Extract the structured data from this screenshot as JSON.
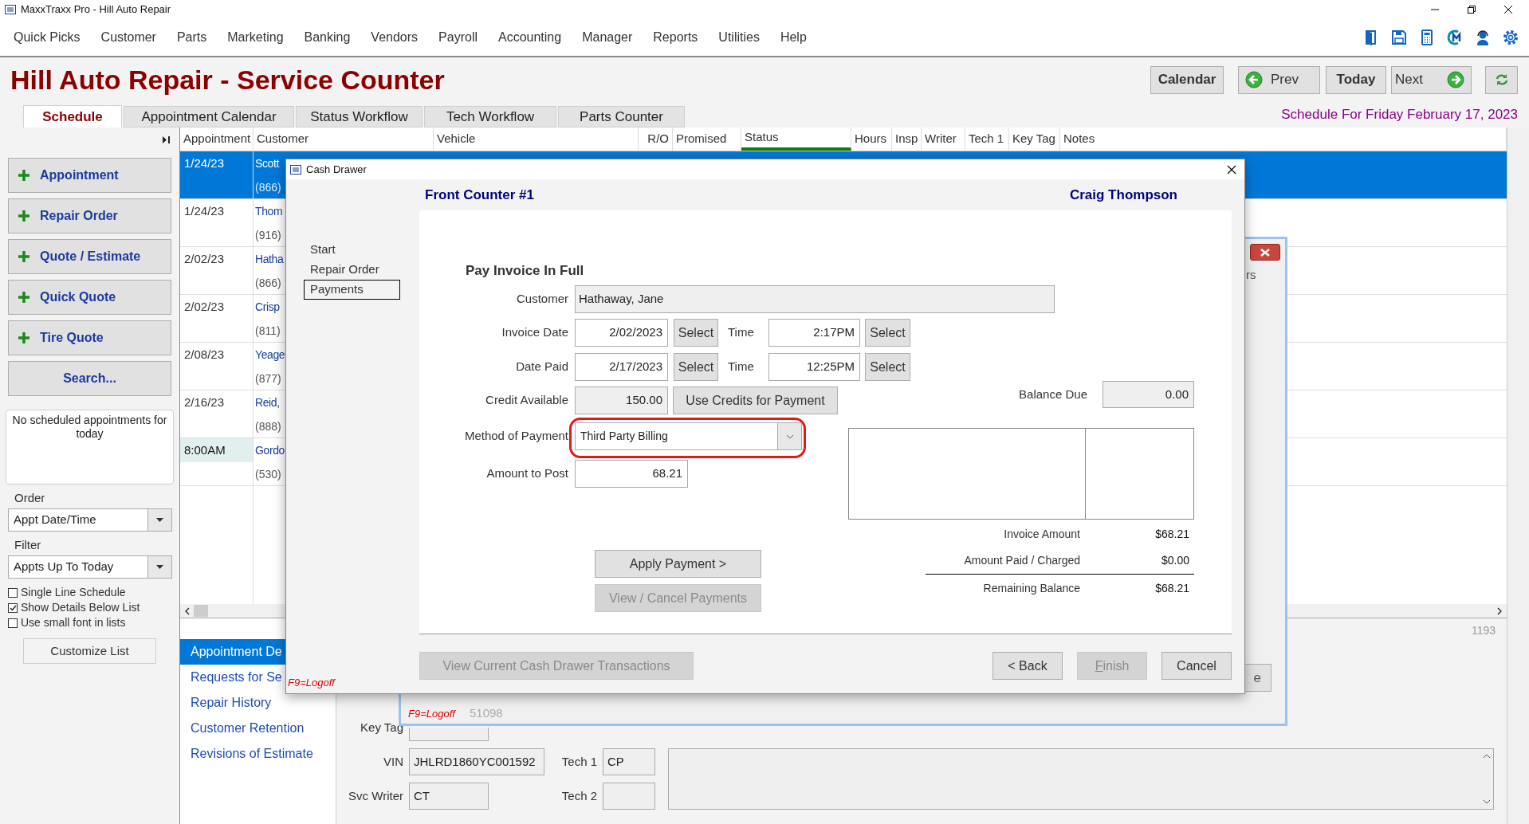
{
  "window": {
    "title": "MaxxTraxx Pro - Hill Auto Repair"
  },
  "menu": [
    "Quick Picks",
    "Customer",
    "Parts",
    "Marketing",
    "Banking",
    "Vendors",
    "Payroll",
    "Accounting",
    "Manager",
    "Reports",
    "Utilities",
    "Help"
  ],
  "header": {
    "title": "Hill Auto Repair - Service Counter",
    "buttons": [
      {
        "kind": "calendar",
        "label": "Calendar"
      },
      {
        "kind": "prev",
        "label": "Prev"
      },
      {
        "kind": "today",
        "label": "Today"
      },
      {
        "kind": "next",
        "label": "Next"
      },
      {
        "kind": "refresh"
      }
    ]
  },
  "tabs": [
    {
      "label": "Schedule",
      "selected": true
    },
    {
      "label": "Appointment Calendar",
      "selected": false
    },
    {
      "label": "Status Workflow",
      "selected": false
    },
    {
      "label": "Tech Workflow",
      "selected": false
    },
    {
      "label": "Parts Counter",
      "selected": false
    }
  ],
  "schedule_date": "Schedule For Friday February 17, 2023",
  "sidebar": {
    "actions": [
      {
        "kind": "add",
        "label": "Appointment"
      },
      {
        "kind": "add",
        "label": "Repair Order"
      },
      {
        "kind": "add",
        "label": "Quote / Estimate"
      },
      {
        "kind": "add",
        "label": "Quick Quote"
      },
      {
        "kind": "add",
        "label": "Tire Quote"
      },
      {
        "kind": "search",
        "label": "Search..."
      }
    ],
    "empty_message": "No scheduled appointments for today",
    "order": {
      "label": "Order",
      "value": "Appt Date/Time"
    },
    "filter": {
      "label": "Filter",
      "value": "Appts Up To Today"
    },
    "options": [
      {
        "label": "Single Line Schedule",
        "checked": false
      },
      {
        "label": "Show Details Below List",
        "checked": true
      },
      {
        "label": "Use small font in lists",
        "checked": false
      }
    ],
    "customize_button": "Customize List"
  },
  "schedule": {
    "columns": [
      {
        "label": "Appointment",
        "sorted": false
      },
      {
        "label": "Customer",
        "sorted": false
      },
      {
        "label": "Vehicle",
        "sorted": false
      },
      {
        "label": "R/O",
        "sorted": false
      },
      {
        "label": "Promised",
        "sorted": false
      },
      {
        "label": "Status",
        "sorted": true
      },
      {
        "label": "Hours",
        "sorted": false
      },
      {
        "label": "Insp",
        "sorted": false
      },
      {
        "label": "Writer",
        "sorted": false
      },
      {
        "label": "Tech 1",
        "sorted": false
      },
      {
        "label": "Key Tag",
        "sorted": false
      },
      {
        "label": "Notes",
        "sorted": false
      }
    ],
    "rows": [
      {
        "kind": "date",
        "appointment": "1/24/23",
        "customer": "Scott",
        "phone": "(866)",
        "selected": true
      },
      {
        "kind": "date",
        "appointment": "1/24/23",
        "customer": "Thom",
        "phone": "(916)",
        "selected": false
      },
      {
        "kind": "date",
        "appointment": "2/02/23",
        "customer": "Hatha",
        "phone": "(866)",
        "selected": false
      },
      {
        "kind": "date",
        "appointment": "2/02/23",
        "customer": "Crisp",
        "phone": "(811)",
        "selected": false
      },
      {
        "kind": "date",
        "appointment": "2/08/23",
        "customer": "Yeage",
        "phone": "(877)",
        "selected": false
      },
      {
        "kind": "date",
        "appointment": "2/16/23",
        "customer": "Reid,",
        "phone": "(888)",
        "selected": false
      },
      {
        "kind": "time",
        "appointment": "8:00AM",
        "customer": "Gordo",
        "phone": "(530)",
        "selected": false
      }
    ]
  },
  "detail_nav": [
    {
      "label": "Appointment De",
      "selected": true
    },
    {
      "label": "Requests for Se",
      "selected": false
    },
    {
      "label": "Repair History",
      "selected": false
    },
    {
      "label": "Customer Retention",
      "selected": false
    },
    {
      "label": "Revisions of Estimate",
      "selected": false
    }
  ],
  "counter": "1193",
  "details": {
    "key_tag": {
      "label": "Key Tag"
    },
    "vin": {
      "label": "VIN",
      "value": "JHLRD1860YC001592"
    },
    "svc_writer": {
      "label": "Svc Writer",
      "value": "CT"
    },
    "tech_1": {
      "label": "Tech 1",
      "value": "CP"
    },
    "tech_2": {
      "label": "Tech 2"
    }
  },
  "back_window": {
    "text_fragment": "rs",
    "button_fragment": "e",
    "hotkey": "F9=Logoff",
    "number": "51098"
  },
  "dialog": {
    "title": "Cash Drawer",
    "station": "Front Counter #1",
    "user": "Craig Thompson",
    "steps": [
      {
        "label": "Start",
        "selected": false
      },
      {
        "label": "Repair Order",
        "selected": false
      },
      {
        "label": "Payments",
        "selected": true
      }
    ],
    "heading": "Pay Invoice In Full",
    "customer": {
      "label": "Customer",
      "value": "Hathaway, Jane"
    },
    "invoice_date": {
      "label": "Invoice Date",
      "date": "2/02/2023",
      "select": "Select",
      "time_label": "Time",
      "time": "2:17PM",
      "time_select": "Select"
    },
    "date_paid": {
      "label": "Date Paid",
      "date": "2/17/2023",
      "select": "Select",
      "time_label": "Time",
      "time": "12:25PM",
      "time_select": "Select"
    },
    "credit": {
      "label": "Credit Available",
      "value": "150.00",
      "button": "Use Credits for Payment"
    },
    "balance_due": {
      "label": "Balance Due",
      "value": "0.00"
    },
    "method": {
      "label": "Method of Payment",
      "value": "Third Party Billing",
      "highlighted": true
    },
    "amount": {
      "label": "Amount to Post",
      "value": "68.21"
    },
    "apply_button": {
      "label": "Apply Payment >",
      "disabled": false
    },
    "view_cancel_button": {
      "label": "View / Cancel Payments",
      "disabled": true
    },
    "summary": [
      {
        "label": "Invoice Amount",
        "value": "$68.21"
      },
      {
        "label": "Amount Paid / Charged",
        "value": "$0.00"
      },
      {
        "label": "Remaining Balance",
        "value": "$68.21"
      }
    ],
    "transactions_button": {
      "label": "View Current Cash Drawer Transactions",
      "disabled": true
    },
    "nav_buttons": [
      {
        "kind": "back",
        "label": "< Back",
        "disabled": false
      },
      {
        "kind": "finish",
        "label": "Finish",
        "disabled": true
      },
      {
        "kind": "cancel",
        "label": "Cancel",
        "disabled": false
      }
    ],
    "hotkey": "F9=Logoff"
  }
}
